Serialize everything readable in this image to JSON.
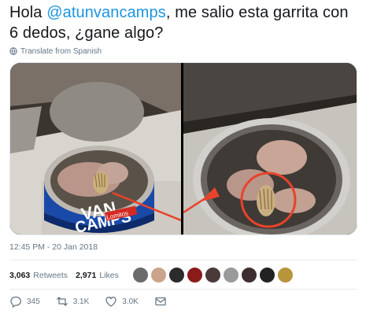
{
  "tweet": {
    "text_prefix": "Hola ",
    "mention": "@atunvancamps",
    "text_suffix": ", me salio esta garrita con 6 dedos, ¿gane algo?",
    "translate_label": "Translate from Spanish",
    "can_label_line1": "VAN",
    "can_label_line2": "CAMPS",
    "can_label_brand": "Lomitos",
    "timestamp": "12:45 PM - 20 Jan 2018"
  },
  "stats": {
    "retweets_count": "3,063",
    "retweets_label": "Retweets",
    "likes_count": "2,971",
    "likes_label": "Likes"
  },
  "avatars": [
    {
      "color": "#6b6b6b"
    },
    {
      "color": "#c9a48a"
    },
    {
      "color": "#2b2b2b"
    },
    {
      "color": "#8b1a1a"
    },
    {
      "color": "#4a3a3a"
    },
    {
      "color": "#9a9a9a"
    },
    {
      "color": "#3d2f2f"
    },
    {
      "color": "#222222"
    },
    {
      "color": "#b8943a"
    }
  ],
  "actions": {
    "replies": "345",
    "retweets": "3.1K",
    "likes": "3.0K"
  },
  "colors": {
    "accent": "#1b95e0",
    "secondary_text": "#657786",
    "highlight": "#e8432b"
  }
}
